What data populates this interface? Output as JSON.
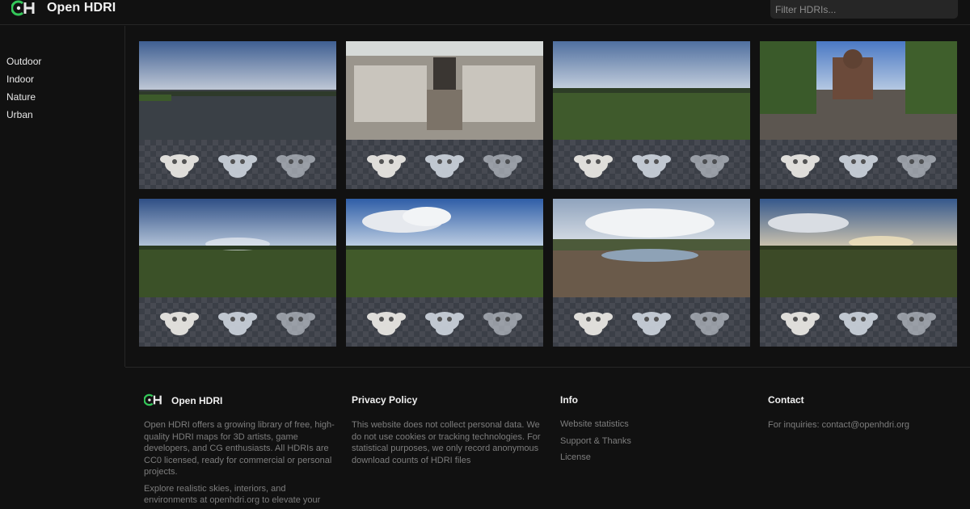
{
  "header": {
    "brand": "Open HDRI",
    "search_placeholder": "Filter HDRIs..."
  },
  "sidebar": {
    "items": [
      {
        "label": "Outdoor"
      },
      {
        "label": "Indoor"
      },
      {
        "label": "Nature"
      },
      {
        "label": "Urban"
      }
    ]
  },
  "grid": {
    "items": [
      {
        "scene": "lake",
        "sky_top": "#3f5f92",
        "sky_bottom": "#c3cbd8",
        "ground": "#3e4348"
      },
      {
        "scene": "tunnel",
        "sky_top": "#d8dcdc",
        "sky_bottom": "#c8c4bc",
        "ground": "#6b6258"
      },
      {
        "scene": "meadow",
        "sky_top": "#4f6f9f",
        "sky_bottom": "#c9d3e0",
        "ground": "#3f5a2c"
      },
      {
        "scene": "church",
        "sky_top": "#4a78c4",
        "sky_bottom": "#b8cbe3",
        "ground": "#5c5650"
      },
      {
        "scene": "field-dusk",
        "sky_top": "#2f4f86",
        "sky_bottom": "#b9c9dc",
        "ground": "#3b5128"
      },
      {
        "scene": "field-cloud",
        "sky_top": "#2f5ea7",
        "sky_bottom": "#c5d4e6",
        "ground": "#415a2a"
      },
      {
        "scene": "quarry-lake",
        "sky_top": "#8fa3bd",
        "sky_bottom": "#dfe4ea",
        "ground": "#6a5a4a"
      },
      {
        "scene": "field-sunset",
        "sky_top": "#35588c",
        "sky_bottom": "#d3c8b0",
        "ground": "#3c4a27"
      }
    ]
  },
  "footer": {
    "about": {
      "title": "Open HDRI",
      "paragraph1": "Open HDRI offers a growing library of free, high-quality HDRI maps for 3D artists, game developers, and CG enthusiasts. All HDRIs are CC0 licensed, ready for commercial or personal projects.",
      "paragraph2": "Explore realistic skies, interiors, and environments at openhdri.org to elevate your"
    },
    "privacy": {
      "title": "Privacy Policy",
      "text": "This website does not collect personal data. We do not use cookies or tracking technologies. For statistical purposes, we only record anonymous download counts of HDRI files"
    },
    "info": {
      "title": "Info",
      "links": [
        {
          "label": "Website statistics"
        },
        {
          "label": "Support & Thanks"
        },
        {
          "label": "License"
        }
      ]
    },
    "contact": {
      "title": "Contact",
      "text": "For inquiries: contact@openhdri.org"
    }
  },
  "colors": {
    "background": "#111111",
    "logo_green": "#34c759",
    "muted_text": "#7d7d7d"
  }
}
